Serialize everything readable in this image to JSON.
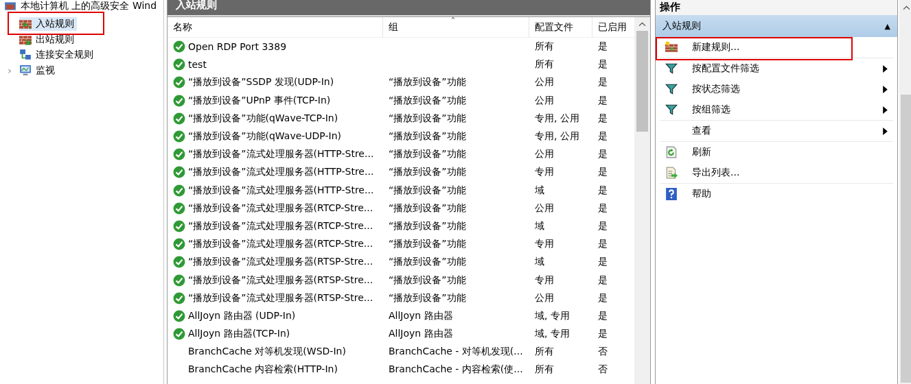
{
  "tree": {
    "root": "本地计算机 上的高级安全 Wind",
    "items": [
      {
        "label": "入站规则",
        "kind": "inbound",
        "selected": true,
        "highlighted": true
      },
      {
        "label": "出站规则",
        "kind": "outbound",
        "selected": false,
        "highlighted": false
      },
      {
        "label": "连接安全规则",
        "kind": "connection",
        "selected": false,
        "highlighted": false
      },
      {
        "label": "监视",
        "kind": "monitor",
        "selected": false,
        "highlighted": false,
        "expander": "›"
      }
    ]
  },
  "table": {
    "title": "入站规则",
    "sort_mark": "ˆ",
    "columns": [
      "名称",
      "组",
      "配置文件",
      "已启用"
    ],
    "rows": [
      {
        "name": "Open RDP Port 3389",
        "group": "",
        "profile": "所有",
        "enabled_text": "是",
        "enabled": true
      },
      {
        "name": "test",
        "group": "",
        "profile": "所有",
        "enabled_text": "是",
        "enabled": true
      },
      {
        "name": "“播放到设备”SSDP 发现(UDP-In)",
        "group": "“播放到设备”功能",
        "profile": "公用",
        "enabled_text": "是",
        "enabled": true
      },
      {
        "name": "“播放到设备”UPnP 事件(TCP-In)",
        "group": "“播放到设备”功能",
        "profile": "公用",
        "enabled_text": "是",
        "enabled": true
      },
      {
        "name": "“播放到设备”功能(qWave-TCP-In)",
        "group": "“播放到设备”功能",
        "profile": "专用, 公用",
        "enabled_text": "是",
        "enabled": true
      },
      {
        "name": "“播放到设备”功能(qWave-UDP-In)",
        "group": "“播放到设备”功能",
        "profile": "专用, 公用",
        "enabled_text": "是",
        "enabled": true
      },
      {
        "name": "“播放到设备”流式处理服务器(HTTP-Stre...",
        "group": "“播放到设备”功能",
        "profile": "公用",
        "enabled_text": "是",
        "enabled": true
      },
      {
        "name": "“播放到设备”流式处理服务器(HTTP-Stre...",
        "group": "“播放到设备”功能",
        "profile": "专用",
        "enabled_text": "是",
        "enabled": true
      },
      {
        "name": "“播放到设备”流式处理服务器(HTTP-Stre...",
        "group": "“播放到设备”功能",
        "profile": "域",
        "enabled_text": "是",
        "enabled": true
      },
      {
        "name": "“播放到设备”流式处理服务器(RTCP-Stre...",
        "group": "“播放到设备”功能",
        "profile": "公用",
        "enabled_text": "是",
        "enabled": true
      },
      {
        "name": "“播放到设备”流式处理服务器(RTCP-Stre...",
        "group": "“播放到设备”功能",
        "profile": "域",
        "enabled_text": "是",
        "enabled": true
      },
      {
        "name": "“播放到设备”流式处理服务器(RTCP-Stre...",
        "group": "“播放到设备”功能",
        "profile": "专用",
        "enabled_text": "是",
        "enabled": true
      },
      {
        "name": "“播放到设备”流式处理服务器(RTSP-Stre...",
        "group": "“播放到设备”功能",
        "profile": "域",
        "enabled_text": "是",
        "enabled": true
      },
      {
        "name": "“播放到设备”流式处理服务器(RTSP-Stre...",
        "group": "“播放到设备”功能",
        "profile": "专用",
        "enabled_text": "是",
        "enabled": true
      },
      {
        "name": "“播放到设备”流式处理服务器(RTSP-Stre...",
        "group": "“播放到设备”功能",
        "profile": "公用",
        "enabled_text": "是",
        "enabled": true
      },
      {
        "name": "AllJoyn 路由器 (UDP-In)",
        "group": "AllJoyn 路由器",
        "profile": "域, 专用",
        "enabled_text": "是",
        "enabled": true
      },
      {
        "name": "AllJoyn 路由器(TCP-In)",
        "group": "AllJoyn 路由器",
        "profile": "域, 专用",
        "enabled_text": "是",
        "enabled": true
      },
      {
        "name": "BranchCache 对等机发现(WSD-In)",
        "group": "BranchCache - 对等机发现(...",
        "profile": "所有",
        "enabled_text": "否",
        "enabled": false
      },
      {
        "name": "BranchCache 内容检索(HTTP-In)",
        "group": "BranchCache - 内容检索(使...",
        "profile": "所有",
        "enabled_text": "否",
        "enabled": false
      }
    ]
  },
  "actions": {
    "title": "操作",
    "section": "入站规则",
    "collapse_mark": "▲",
    "items": [
      {
        "label": "新建规则...",
        "kind": "new-rule",
        "submenu": false,
        "highlighted": true,
        "separator_after": true
      },
      {
        "label": "按配置文件筛选",
        "kind": "filter",
        "submenu": true,
        "highlighted": false,
        "separator_after": false
      },
      {
        "label": "按状态筛选",
        "kind": "filter",
        "submenu": true,
        "highlighted": false,
        "separator_after": false
      },
      {
        "label": "按组筛选",
        "kind": "filter",
        "submenu": true,
        "highlighted": false,
        "separator_after": true
      },
      {
        "label": "查看",
        "kind": "plain",
        "submenu": true,
        "highlighted": false,
        "separator_after": true
      },
      {
        "label": "刷新",
        "kind": "refresh",
        "submenu": false,
        "highlighted": false,
        "separator_after": false
      },
      {
        "label": "导出列表...",
        "kind": "export",
        "submenu": false,
        "highlighted": false,
        "separator_after": true
      },
      {
        "label": "帮助",
        "kind": "help",
        "submenu": false,
        "highlighted": false,
        "separator_after": false
      }
    ]
  }
}
